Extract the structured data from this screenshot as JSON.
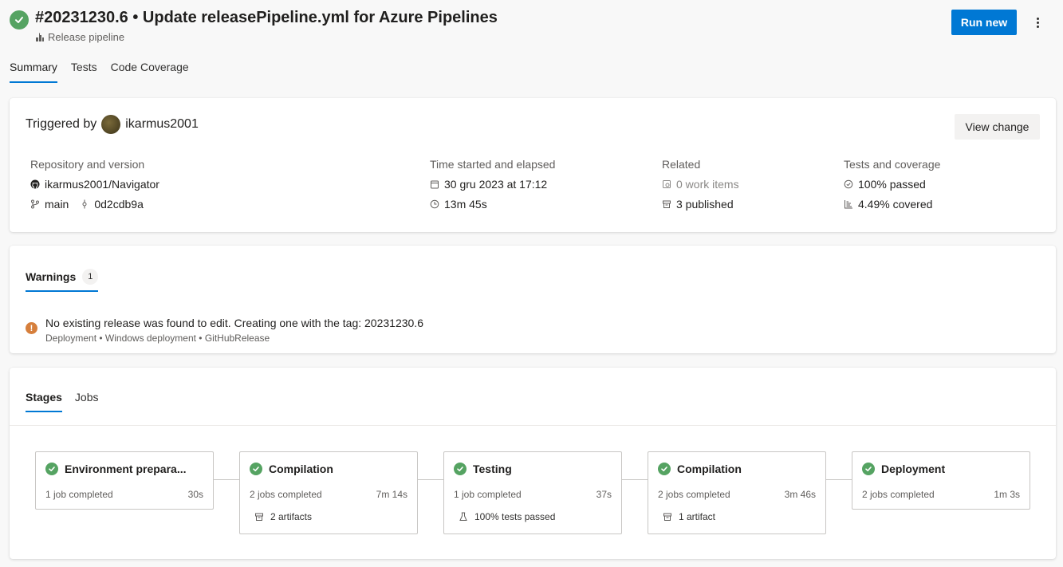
{
  "header": {
    "title": "#20231230.6 • Update releasePipeline.yml for Azure Pipelines",
    "subtitle": "Release pipeline",
    "run_new_label": "Run new"
  },
  "tabs": [
    {
      "label": "Summary",
      "active": true
    },
    {
      "label": "Tests",
      "active": false
    },
    {
      "label": "Code Coverage",
      "active": false
    }
  ],
  "trigger": {
    "prefix": "Triggered by",
    "user": "ikarmus2001",
    "view_change_label": "View change"
  },
  "details": {
    "repo": {
      "label": "Repository and version",
      "name": "ikarmus2001/Navigator",
      "branch": "main",
      "commit": "0d2cdb9a"
    },
    "time": {
      "label": "Time started and elapsed",
      "started": "30 gru 2023 at 17:12",
      "elapsed": "13m 45s"
    },
    "related": {
      "label": "Related",
      "work_items": "0 work items",
      "published": "3 published"
    },
    "tests": {
      "label": "Tests and coverage",
      "passed": "100% passed",
      "covered": "4.49% covered"
    }
  },
  "warnings": {
    "tab_label": "Warnings",
    "count": "1",
    "message": "No existing release was found to edit. Creating one with the tag: 20231230.6",
    "source": "Deployment • Windows deployment • GitHubRelease"
  },
  "stage_tabs": [
    {
      "label": "Stages",
      "active": true
    },
    {
      "label": "Jobs",
      "active": false
    }
  ],
  "stages": [
    {
      "name": "Environment prepara...",
      "jobs": "1 job completed",
      "time": "30s",
      "extra": ""
    },
    {
      "name": "Compilation",
      "jobs": "2 jobs completed",
      "time": "7m 14s",
      "extra": "2 artifacts"
    },
    {
      "name": "Testing",
      "jobs": "1 job completed",
      "time": "37s",
      "extra": "100% tests passed"
    },
    {
      "name": "Compilation",
      "jobs": "2 jobs completed",
      "time": "3m 46s",
      "extra": "1 artifact"
    },
    {
      "name": "Deployment",
      "jobs": "2 jobs completed",
      "time": "1m 3s",
      "extra": ""
    }
  ],
  "colors": {
    "success": "#55a362",
    "accent": "#0078d4",
    "warning": "#d67f3c"
  }
}
